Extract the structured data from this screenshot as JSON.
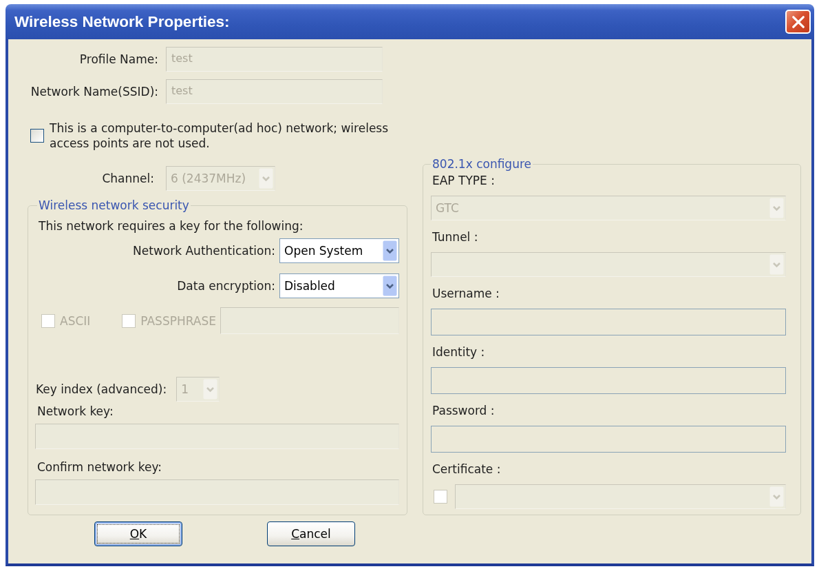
{
  "window": {
    "title": "Wireless Network Properties:"
  },
  "profile": [
    {
      "label": "Profile Name:",
      "value": "test",
      "disabled": true
    },
    {
      "label": "Network Name(SSID):",
      "value": "test",
      "disabled": true
    }
  ],
  "ad_hoc": {
    "label": "This is a computer-to-computer(ad hoc) network; wireless access points are not used.",
    "checked": false
  },
  "channel": {
    "label": "Channel:",
    "value": "6 (2437MHz)",
    "disabled": true
  },
  "security": {
    "title": "Wireless network security",
    "intro": "This network requires a key for the following:",
    "selects": [
      {
        "label": "Network Authentication:",
        "value": "Open System",
        "disabled": false
      },
      {
        "label": "Data encryption:",
        "value": "Disabled",
        "disabled": false
      }
    ],
    "options": [
      {
        "label": "ASCII",
        "checked": false,
        "disabled": true
      },
      {
        "label": "PASSPHRASE",
        "checked": false,
        "disabled": true
      }
    ],
    "passphrase_field": {
      "disabled": true
    },
    "key_index": {
      "label": "Key index (advanced):",
      "value": "1",
      "disabled": true
    },
    "keys": [
      {
        "label": "Network key:",
        "disabled": true
      },
      {
        "label": "Confirm network key:",
        "disabled": true
      }
    ]
  },
  "eap": {
    "title": "802.1x configure",
    "fields": [
      {
        "kind": "select",
        "label": "EAP TYPE :",
        "value": "GTC",
        "disabled": true
      },
      {
        "kind": "select",
        "label": "Tunnel :",
        "disabled": true
      },
      {
        "kind": "text",
        "label": "Username :",
        "disabled": false
      },
      {
        "kind": "text",
        "label": "Identity :",
        "disabled": false
      },
      {
        "kind": "text",
        "label": "Password :",
        "disabled": false
      },
      {
        "kind": "certificate",
        "label": "Certificate :",
        "checked": false,
        "disabled": true
      }
    ]
  },
  "buttons": [
    {
      "label": "OK",
      "default": true
    },
    {
      "label": "Cancel",
      "default": false
    }
  ]
}
